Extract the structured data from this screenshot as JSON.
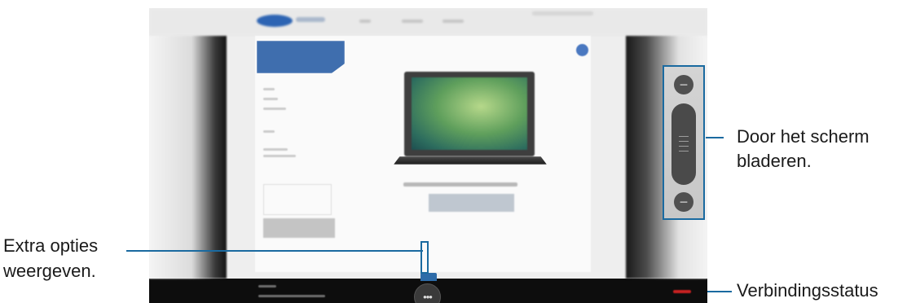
{
  "remote_screen": {
    "more_options_glyph": "•••",
    "scroll_up_glyph": "−",
    "scroll_down_glyph": "−"
  },
  "callouts": {
    "scroll_line1": "Door het scherm",
    "scroll_line2": "bladeren.",
    "more_line1": "Extra opties",
    "more_line2": "weergeven.",
    "status": "Verbindingsstatus"
  },
  "colors": {
    "accent": "#1a6aa0",
    "status_indicator": "#c62121"
  }
}
